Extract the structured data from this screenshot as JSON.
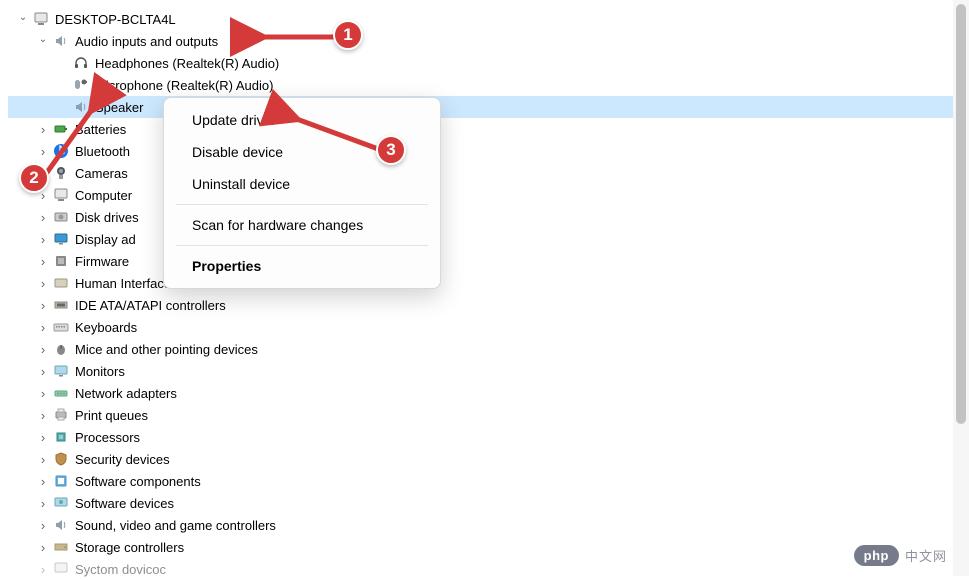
{
  "tree": {
    "root": {
      "label": "DESKTOP-BCLTA4L",
      "icon": "computer-icon",
      "expanded": true
    },
    "audio": {
      "label": "Audio inputs and outputs",
      "icon": "speaker-icon",
      "expanded": true
    },
    "audio_children": [
      {
        "label": "Headphones (Realtek(R) Audio)",
        "icon": "headphones-icon"
      },
      {
        "label": "Microphone (Realtek(R) Audio)",
        "icon": "microphone-icon"
      },
      {
        "label": "Speakers (Realtek(R) Audio)",
        "icon": "speaker-icon",
        "selected": true,
        "displayed": "Speaker"
      }
    ],
    "categories": [
      {
        "label": "Batteries",
        "icon": "battery-icon"
      },
      {
        "label": "Bluetooth",
        "icon": "bluetooth-icon"
      },
      {
        "label": "Cameras",
        "icon": "camera-icon"
      },
      {
        "label": "Computer",
        "icon": "computer-icon"
      },
      {
        "label": "Disk drives",
        "icon": "disk-icon"
      },
      {
        "label": "Display adapters",
        "icon": "display-icon",
        "display_override": "Display ad"
      },
      {
        "label": "Firmware",
        "icon": "firmware-icon"
      },
      {
        "label": "Human Interface Devices",
        "icon": "hid-icon"
      },
      {
        "label": "IDE ATA/ATAPI controllers",
        "icon": "ide-icon"
      },
      {
        "label": "Keyboards",
        "icon": "keyboard-icon"
      },
      {
        "label": "Mice and other pointing devices",
        "icon": "mouse-icon"
      },
      {
        "label": "Monitors",
        "icon": "monitor-icon"
      },
      {
        "label": "Network adapters",
        "icon": "network-icon"
      },
      {
        "label": "Print queues",
        "icon": "printer-icon"
      },
      {
        "label": "Processors",
        "icon": "cpu-icon"
      },
      {
        "label": "Security devices",
        "icon": "security-icon"
      },
      {
        "label": "Software components",
        "icon": "software-icon"
      },
      {
        "label": "Software devices",
        "icon": "software-icon"
      },
      {
        "label": "Sound, video and game controllers",
        "icon": "sound-icon"
      },
      {
        "label": "Storage controllers",
        "icon": "storage-icon"
      },
      {
        "label": "System devices",
        "icon": "system-icon",
        "display_override": "Syctom dovicoc"
      }
    ]
  },
  "context_menu": {
    "update": "Update driver",
    "disable": "Disable device",
    "uninstall": "Uninstall device",
    "scan": "Scan for hardware changes",
    "properties": "Properties"
  },
  "annotations": {
    "b1": "1",
    "b2": "2",
    "b3": "3"
  },
  "watermark": {
    "logo": "php",
    "text": "中文网"
  }
}
